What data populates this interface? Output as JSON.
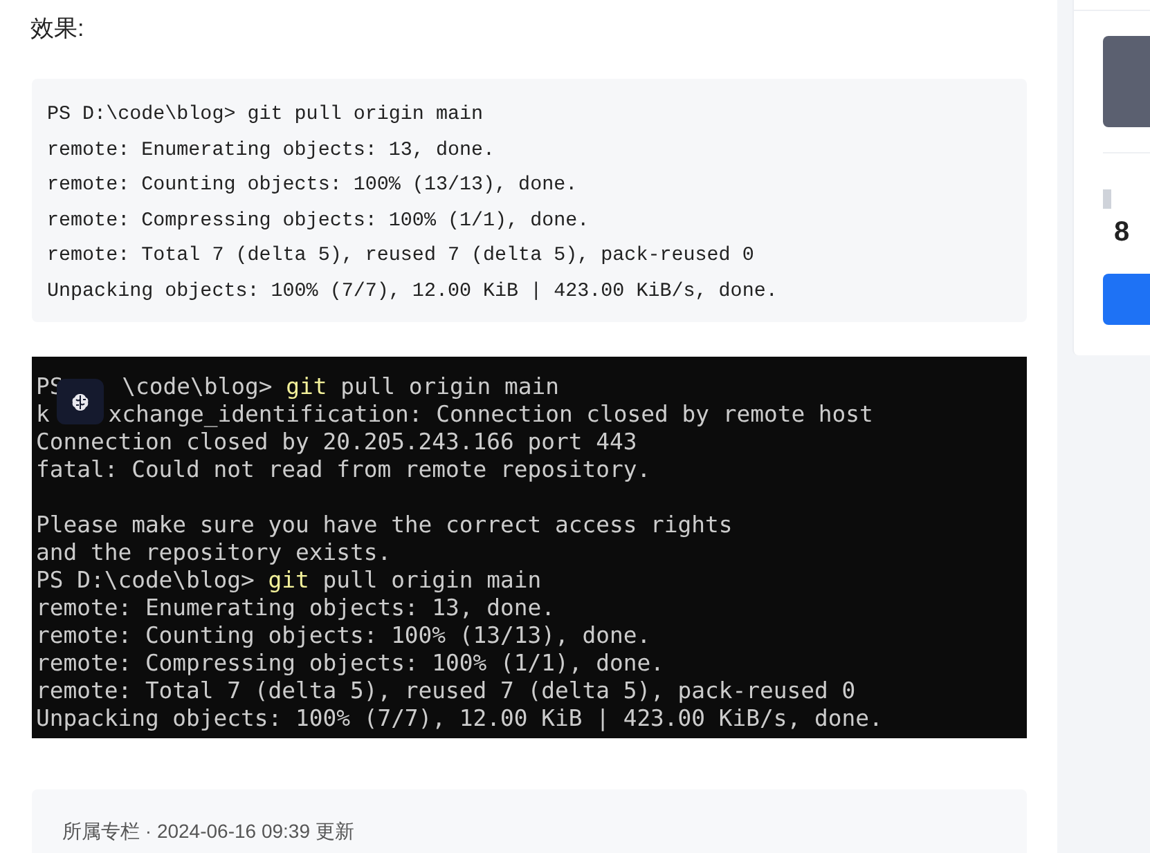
{
  "heading": "效果:",
  "code_block": {
    "lines": [
      "PS D:\\code\\blog> git pull origin main",
      "remote: Enumerating objects: 13, done.",
      "remote: Counting objects: 100% (13/13), done.",
      "remote: Compressing objects: 100% (1/1), done.",
      "remote: Total 7 (delta 5), reused 7 (delta 5), pack-reused 0",
      "Unpacking objects: 100% (7/7), 12.00 KiB | 423.00 KiB/s, done."
    ]
  },
  "terminal_screenshot": {
    "lines": [
      [
        {
          "kind": "text",
          "text": "PS"
        },
        {
          "kind": "gap"
        },
        {
          "kind": "text",
          "text": "\\code\\blog> "
        },
        {
          "kind": "command",
          "text": "git"
        },
        {
          "kind": "text",
          "text": " pull origin main"
        }
      ],
      [
        {
          "kind": "text",
          "text": "k"
        },
        {
          "kind": "gap"
        },
        {
          "kind": "text",
          "text": "xchange_identification: Connection closed by remote host"
        }
      ],
      [
        {
          "kind": "text",
          "text": "Connection closed by 20.205.243.166 port 443"
        }
      ],
      [
        {
          "kind": "text",
          "text": "fatal: Could not read from remote repository."
        }
      ],
      [
        {
          "kind": "blank"
        }
      ],
      [
        {
          "kind": "text",
          "text": "Please make sure you have the correct access rights"
        }
      ],
      [
        {
          "kind": "text",
          "text": "and the repository exists."
        }
      ],
      [
        {
          "kind": "text",
          "text": "PS D:\\code\\blog> "
        },
        {
          "kind": "command",
          "text": "git"
        },
        {
          "kind": "text",
          "text": " pull origin main"
        }
      ],
      [
        {
          "kind": "text",
          "text": "remote: Enumerating objects: 13, done."
        }
      ],
      [
        {
          "kind": "text",
          "text": "remote: Counting objects: 100% (13/13), done."
        }
      ],
      [
        {
          "kind": "text",
          "text": "remote: Compressing objects: 100% (1/1), done."
        }
      ],
      [
        {
          "kind": "text",
          "text": "remote: Total 7 (delta 5), reused 7 (delta 5), pack-reused 0"
        }
      ],
      [
        {
          "kind": "text",
          "text": "Unpacking objects: 100% (7/7), 12.00 KiB | 423.00 KiB/s, done."
        }
      ]
    ]
  },
  "footer": {
    "text": "所属专栏 · 2024-06-16 09:39 更新"
  },
  "sidebar": {
    "stat_value": "8"
  }
}
